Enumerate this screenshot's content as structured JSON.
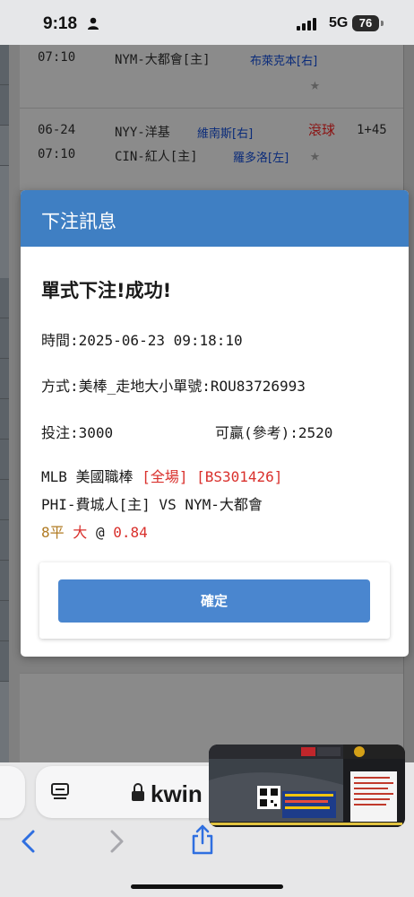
{
  "status_bar": {
    "time": "9:18",
    "network": "5G",
    "battery": "76"
  },
  "background_rows": [
    {
      "time": "07:10",
      "team": "NYM-大都會[主]",
      "pitcher": "布萊克本[右]"
    },
    {
      "date": "06-24",
      "time": "07:10",
      "team1": "NYY-洋基",
      "pitcher1": "維南斯[右]",
      "team2": "CIN-紅人[主]",
      "pitcher2": "羅多洛[左]",
      "live": "滾球",
      "odds": "1+45"
    }
  ],
  "modal": {
    "title": "下注訊息",
    "success": "單式下注!成功!",
    "time_line": "時間:2025-06-23 09:18:10",
    "method_line": "方式:美棒_走地大小單號:ROU83726993",
    "stake_line": "投注:3000",
    "win_line": "可贏(參考):2520",
    "league": "MLB 美國職棒",
    "scope": "[全場]",
    "code": "[BS301426]",
    "match": "PHI-費城人[主] VS NYM-大都會",
    "line_value": "8平",
    "pick": "大",
    "at": "@",
    "odds": "0.84",
    "confirm_label": "確定"
  },
  "browser": {
    "url": "kwin"
  },
  "colors": {
    "header": "#3f7fc3",
    "button": "#4a86cf",
    "accent_red": "#d9302c",
    "line_gold": "#b07a22"
  }
}
